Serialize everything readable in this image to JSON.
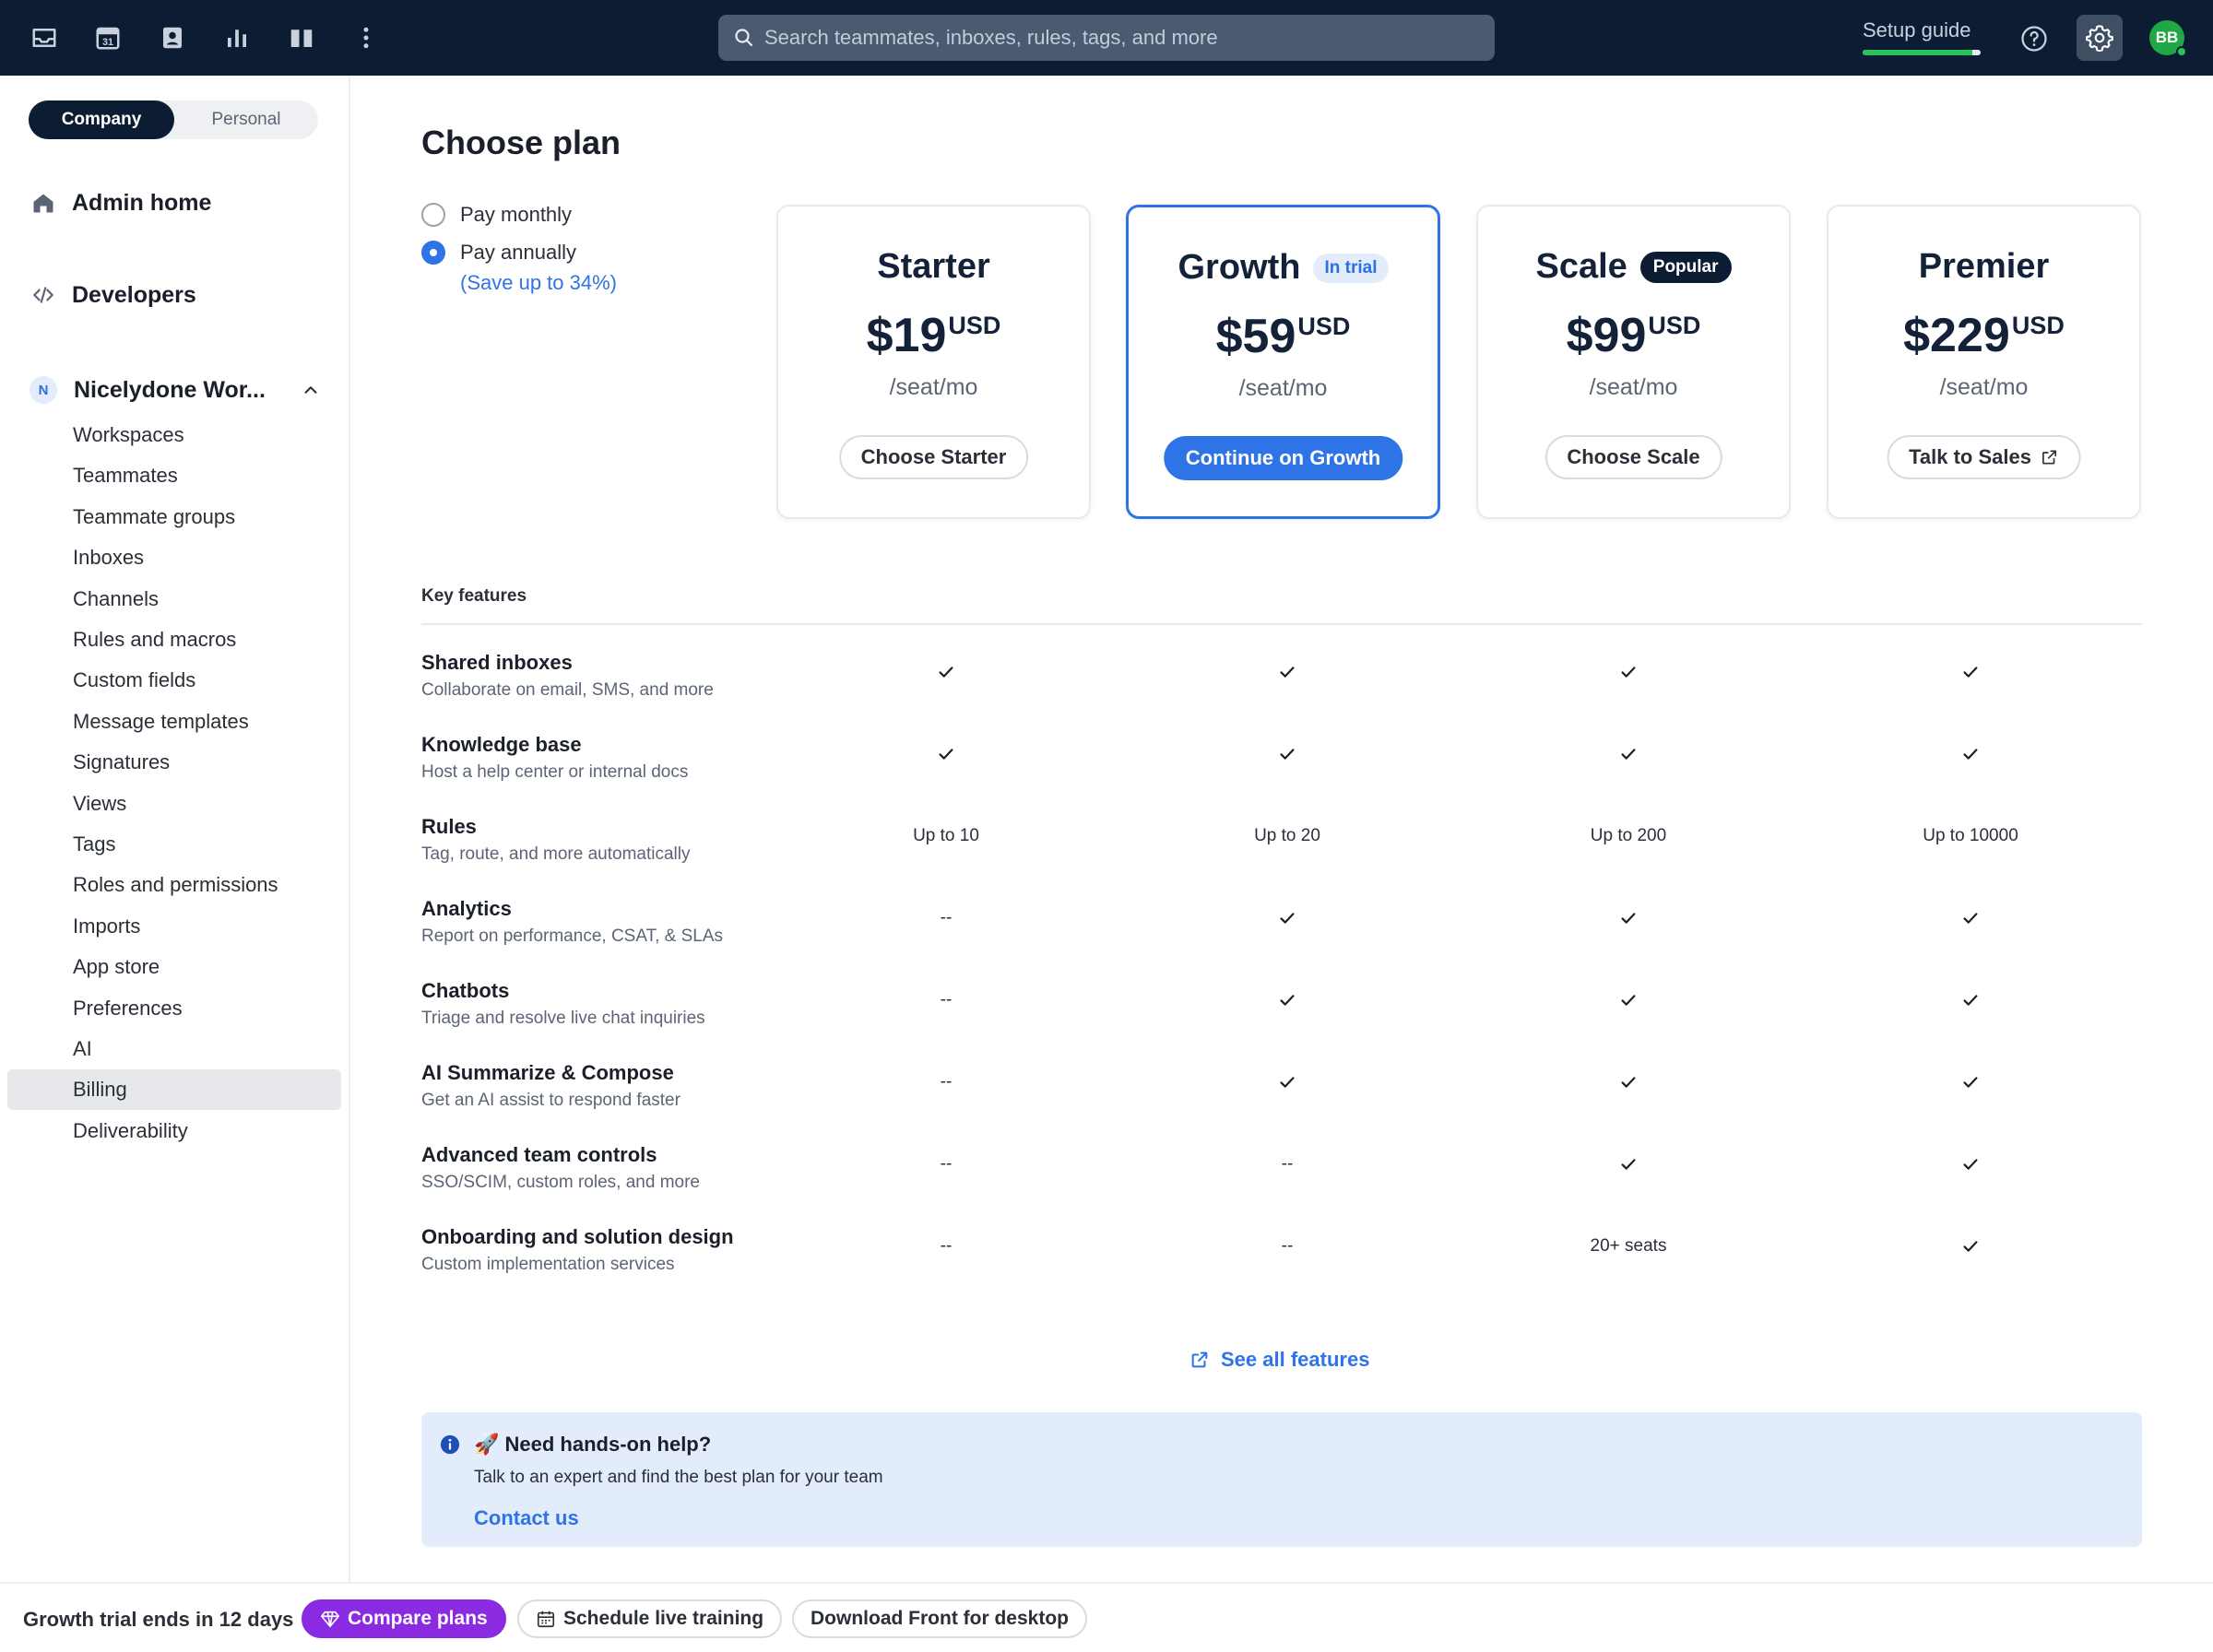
{
  "topbar": {
    "icons": [
      "inbox-icon",
      "calendar-icon",
      "contacts-icon",
      "analytics-icon",
      "knowledge-base-icon",
      "more-icon"
    ],
    "calendar_day": "31",
    "search_placeholder": "Search teammates, inboxes, rules, tags, and more",
    "setup_guide_label": "Setup guide",
    "setup_progress": 0.93,
    "avatar_initials": "BB"
  },
  "sidebar": {
    "segment": {
      "active": "Company",
      "inactive": "Personal"
    },
    "admin_home": "Admin home",
    "developers": "Developers",
    "workspace": {
      "badge": "N",
      "title": "Nicelydone Wor..."
    },
    "items": [
      {
        "label": "Workspaces",
        "active": false
      },
      {
        "label": "Teammates",
        "active": false
      },
      {
        "label": "Teammate groups",
        "active": false
      },
      {
        "label": "Inboxes",
        "active": false
      },
      {
        "label": "Channels",
        "active": false
      },
      {
        "label": "Rules and macros",
        "active": false
      },
      {
        "label": "Custom fields",
        "active": false
      },
      {
        "label": "Message templates",
        "active": false
      },
      {
        "label": "Signatures",
        "active": false
      },
      {
        "label": "Views",
        "active": false
      },
      {
        "label": "Tags",
        "active": false
      },
      {
        "label": "Roles and permissions",
        "active": false
      },
      {
        "label": "Imports",
        "active": false
      },
      {
        "label": "App store",
        "active": false
      },
      {
        "label": "Preferences",
        "active": false
      },
      {
        "label": "AI",
        "active": false
      },
      {
        "label": "Billing",
        "active": true
      },
      {
        "label": "Deliverability",
        "active": false
      }
    ]
  },
  "main": {
    "title": "Choose plan",
    "billing": {
      "monthly": "Pay monthly",
      "annually": "Pay annually",
      "selected": "annually",
      "save_note": "(Save up to 34%)"
    },
    "plans": [
      {
        "name": "Starter",
        "badge": "",
        "price": "$19",
        "currency": "USD",
        "per": "/seat/mo",
        "button": "Choose Starter"
      },
      {
        "name": "Growth",
        "badge": "In trial",
        "price": "$59",
        "currency": "USD",
        "per": "/seat/mo",
        "button": "Continue on Growth"
      },
      {
        "name": "Scale",
        "badge": "Popular",
        "price": "$99",
        "currency": "USD",
        "per": "/seat/mo",
        "button": "Choose Scale"
      },
      {
        "name": "Premier",
        "badge": "",
        "price": "$229",
        "currency": "USD",
        "per": "/seat/mo",
        "button": "Talk to Sales"
      }
    ],
    "key_features_label": "Key features",
    "features": [
      {
        "name": "Shared inboxes",
        "desc": "Collaborate on email, SMS, and more",
        "values": [
          "check",
          "check",
          "check",
          "check"
        ]
      },
      {
        "name": "Knowledge base",
        "desc": "Host a help center or internal docs",
        "values": [
          "check",
          "check",
          "check",
          "check"
        ]
      },
      {
        "name": "Rules",
        "desc": "Tag, route, and more automatically",
        "values": [
          "Up to 10",
          "Up to 20",
          "Up to 200",
          "Up to 10000"
        ]
      },
      {
        "name": "Analytics",
        "desc": "Report on performance, CSAT, & SLAs",
        "values": [
          "--",
          "check",
          "check",
          "check"
        ]
      },
      {
        "name": "Chatbots",
        "desc": "Triage and resolve live chat inquiries",
        "values": [
          "--",
          "check",
          "check",
          "check"
        ]
      },
      {
        "name": "AI Summarize & Compose",
        "desc": "Get an AI assist to respond faster",
        "values": [
          "--",
          "check",
          "check",
          "check"
        ]
      },
      {
        "name": "Advanced team controls",
        "desc": "SSO/SCIM, custom roles, and more",
        "values": [
          "--",
          "--",
          "check",
          "check"
        ]
      },
      {
        "name": "Onboarding and solution design",
        "desc": "Custom implementation services",
        "values": [
          "--",
          "--",
          "20+ seats",
          "check"
        ]
      }
    ],
    "see_all": "See all features",
    "help": {
      "title": "🚀 Need hands-on help?",
      "text": "Talk to an expert and find the best plan for your team",
      "link": "Contact us"
    }
  },
  "footer": {
    "trial_text": "Growth trial ends in 12 days",
    "compare": "Compare plans",
    "schedule": "Schedule live training",
    "download": "Download Front for desktop"
  },
  "colors": {
    "topbar": "#0c1d33",
    "accent": "#2e74e6",
    "purple": "#8a2be2",
    "success": "#2ac05a"
  }
}
